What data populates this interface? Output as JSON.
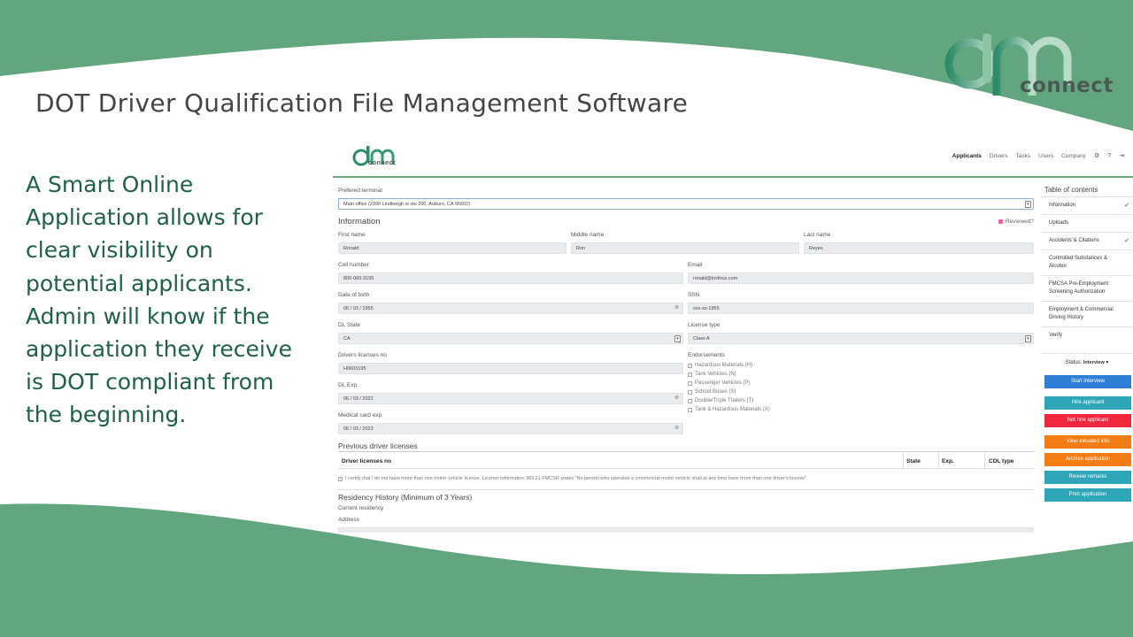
{
  "slide": {
    "title": "DOT Driver Qualification File Management Software",
    "body": "A Smart Online Application allows for clear visibility on potential applicants. Admin will know if the application they receive is DOT compliant from the beginning.",
    "brand_text": "connect",
    "colors": {
      "wave_green": "#62a67f",
      "body_text": "#1f6147",
      "title_text": "#444444"
    }
  },
  "app": {
    "logo_text": "connect",
    "nav": [
      "Applicants",
      "Drivers",
      "Tasks",
      "Users",
      "Company"
    ],
    "nav_icons": [
      "gear-icon",
      "help-icon",
      "logout-icon"
    ],
    "form": {
      "preferred_terminal_label": "Prefered terminal",
      "preferred_terminal_value": "Main office (2390 Lindbergh st ste 200, Auburn, CA 95602)",
      "information_heading": "Information",
      "reviewed_label": "Reviewed?",
      "first_name_label": "First name",
      "first_name_value": "Ronald",
      "middle_name_label": "Middle name",
      "middle_name_value": "Ron",
      "last_name_label": "Last name",
      "last_name_value": "Reyes",
      "cell_label": "Cell number",
      "cell_value": "800-060-3195",
      "email_label": "Email",
      "email_value": "ronald@invitrux.com",
      "dob_label": "Date of birth",
      "dob_value": "06 / 03 / 1955",
      "ssn_label": "SSN",
      "ssn_value": "xxx-xx-1955",
      "dl_state_label": "DL State",
      "dl_state_value": "CA",
      "license_type_label": "License type",
      "license_type_value": "Class A",
      "dl_no_label": "Drivers licenses no",
      "dl_no_value": "H0603195",
      "endorsements_label": "Endorsements",
      "endorsements": [
        {
          "label": "Hazardous Materials (H)",
          "checked": true
        },
        {
          "label": "Tank Vehicles (N)",
          "checked": true
        },
        {
          "label": "Passenger Vehicles (P)",
          "checked": false
        },
        {
          "label": "School Buses (S)",
          "checked": false
        },
        {
          "label": "Double/Triple Trailers (T)",
          "checked": false
        },
        {
          "label": "Tank & Hazardous Materials (X)",
          "checked": false
        }
      ],
      "dl_exp_label": "DL Exp.",
      "dl_exp_value": "06 / 03 / 2022",
      "medical_label": "Medical card exp.",
      "medical_value": "06 / 03 / 2023",
      "prev_licenses_heading": "Previous driver licenses",
      "table_headers": [
        "Driver licenses no",
        "State",
        "Exp.",
        "CDL type"
      ],
      "certify_text": "I certify that I do not have more than one motor vehicle license. License information 383.21 FMCSR states \"No person who operates a commercial motor vehicle shall at any time have more than one driver's license\".",
      "residency_heading": "Residency History (Minimum of 3 Years)",
      "current_residency_label": "Current residency",
      "address_label": "Address"
    },
    "sidebar": {
      "toc_title": "Table of contents",
      "items": [
        {
          "label": "Information",
          "done": true
        },
        {
          "label": "Uploads",
          "done": false
        },
        {
          "label": "Accidents & Citations",
          "done": true
        },
        {
          "label": "Controlled Substances & Alcohol",
          "done": false
        },
        {
          "label": "FMCSA Pre-Employment Screening Authorization",
          "done": false
        },
        {
          "label": "Employment & Commercial Driving History",
          "done": false
        },
        {
          "label": "Verify",
          "done": false
        }
      ],
      "status_label": "Status:",
      "status_value": "Interview",
      "buttons": {
        "start_interview": "Start interview",
        "hire": "Hire applicant",
        "not_hire": "Not hire applicant",
        "view_elevated": "View elevated info",
        "archive": "Archive application",
        "review_remarks": "Review remarks",
        "print": "Print application"
      }
    }
  }
}
